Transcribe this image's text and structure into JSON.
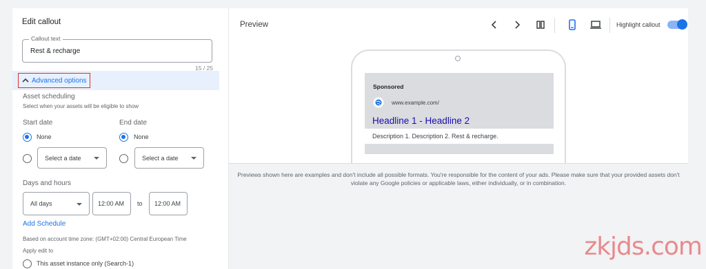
{
  "editor": {
    "title": "Edit callout",
    "callout_label": "Callout text",
    "callout_value": "Rest & recharge",
    "counter": "15 / 25",
    "advanced_label": "Advanced options",
    "asset_scheduling": "Asset scheduling",
    "scheduling_hint": "Select when your assets will be eligible to show",
    "start_date": "Start date",
    "end_date": "End date",
    "none": "None",
    "select_date": "Select a date",
    "days_hours": "Days and hours",
    "all_days": "All days",
    "start_time": "12:00 AM",
    "to": "to",
    "end_time": "12:00 AM",
    "add_schedule": "Add Schedule",
    "timezone": "Based on account time zone: (GMT+02:00) Central European Time",
    "apply_edit": "Apply edit to",
    "apply_option": "This asset instance only (Search-1)"
  },
  "preview": {
    "title": "Preview",
    "highlight_label": "Highlight callout",
    "sponsored": "Sponsored",
    "url": "www.example.com/",
    "headline": "Headline 1 - Headline 2",
    "description": "Description 1. Description 2. Rest & recharge.",
    "note": "Previews shown here are examples and don't include all possible formats. You're responsible for the content of your ads. Please make sure that your provided assets don't violate any Google policies or applicable laws, either individually, or in combination."
  },
  "watermark": "zkjds.com",
  "colors": {
    "accent": "#1a73e8",
    "highlight_border": "#d93025",
    "watermark": "#e88a8e"
  }
}
